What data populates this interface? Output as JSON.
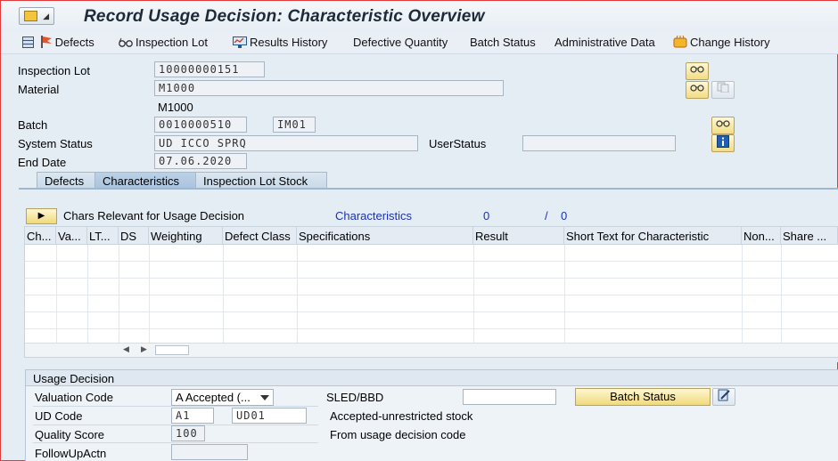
{
  "window": {
    "title": "Record Usage Decision: Characteristic Overview"
  },
  "toolbar": {
    "items": [
      {
        "label": "Defects",
        "icon": "defects-icon"
      },
      {
        "label": "Inspection Lot",
        "icon": "glasses-icon"
      },
      {
        "label": "Results History",
        "icon": "results-history-icon"
      },
      {
        "label": "Defective Quantity"
      },
      {
        "label": "Batch Status"
      },
      {
        "label": "Administrative Data"
      },
      {
        "label": "Change History",
        "icon": "change-history-icon"
      }
    ]
  },
  "header": {
    "inspection_lot_label": "Inspection Lot",
    "inspection_lot_value": "10000000151",
    "material_label": "Material",
    "material_value": "M1000",
    "material_text": "M1000",
    "batch_label": "Batch",
    "batch_value": "0010000510",
    "batch_plant": "IM01",
    "system_status_label": "System Status",
    "system_status_value": "UD   ICCO SPRQ",
    "user_status_label": "UserStatus",
    "user_status_value": "",
    "end_date_label": "End Date",
    "end_date_value": "07.06.2020"
  },
  "tabs": [
    {
      "label": "Defects",
      "active": false
    },
    {
      "label": "Characteristics",
      "active": true
    },
    {
      "label": "Inspection Lot Stock",
      "active": false
    }
  ],
  "chars_panel": {
    "relevant_label": "Chars Relevant for Usage Decision",
    "characteristics_link": "Characteristics",
    "count_a": "0",
    "slash": "/",
    "count_b": "0"
  },
  "grid": {
    "columns": [
      "Ch...",
      "Va...",
      "LT...",
      "DS",
      "Weighting",
      "Defect Class",
      "Specifications",
      "Result",
      "Short Text for Characteristic",
      "Non...",
      "Share ..."
    ]
  },
  "usage": {
    "title": "Usage Decision",
    "valuation_label": "Valuation Code",
    "valuation_value": "A Accepted (...",
    "sled_label": "SLED/BBD",
    "sled_value": "",
    "batch_status_button": "Batch Status",
    "ud_code_label": "UD Code",
    "ud_code_a": "A1",
    "ud_code_b": "UD01",
    "ud_code_text": "Accepted-unrestricted stock",
    "quality_score_label": "Quality Score",
    "quality_score_value": "100",
    "quality_score_text": "From usage decision code",
    "followup_label": "FollowUpActn",
    "followup_value": ""
  },
  "colors": {
    "accent_link": "#1832b8",
    "frame_red": "#e23b3b"
  }
}
